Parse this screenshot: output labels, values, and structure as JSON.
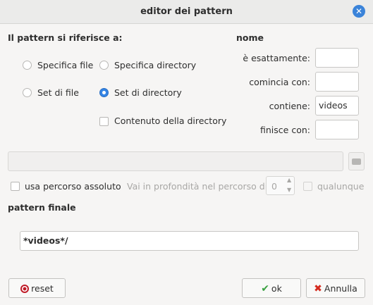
{
  "window": {
    "title": "editor dei pattern"
  },
  "pattern_ref": {
    "heading": "Il pattern si riferisce a:",
    "options": {
      "specifica_file": "Specifica file",
      "specifica_directory": "Specifica directory",
      "set_di_file": "Set di file",
      "set_di_directory": "Set di directory"
    },
    "selected": "Set di directory",
    "contenuto_directory": {
      "label": "Contenuto della directory",
      "checked": false
    }
  },
  "nome": {
    "heading": "nome",
    "fields": {
      "esattamente": {
        "label": "è esattamente:",
        "value": ""
      },
      "comincia": {
        "label": "comincia con:",
        "value": ""
      },
      "contiene": {
        "label": "contiene:",
        "value": "videos"
      },
      "finisce": {
        "label": "finisce con:",
        "value": ""
      }
    }
  },
  "path": {
    "value": ""
  },
  "options_row": {
    "absolute_label": "usa percorso assoluto",
    "absolute_checked": false,
    "depth_label": "Vai in profondità nel percorso di:",
    "depth_value": "0",
    "any_label": "qualunque",
    "any_checked": false
  },
  "final": {
    "heading": "pattern finale",
    "value": "*videos*/"
  },
  "buttons": {
    "reset": "reset",
    "ok": "ok",
    "cancel": "Annulla"
  },
  "colors": {
    "accent": "#3584e4",
    "ok_green": "#3aa142",
    "cancel_red": "#d42a1e",
    "reset_red": "#c01c28"
  }
}
